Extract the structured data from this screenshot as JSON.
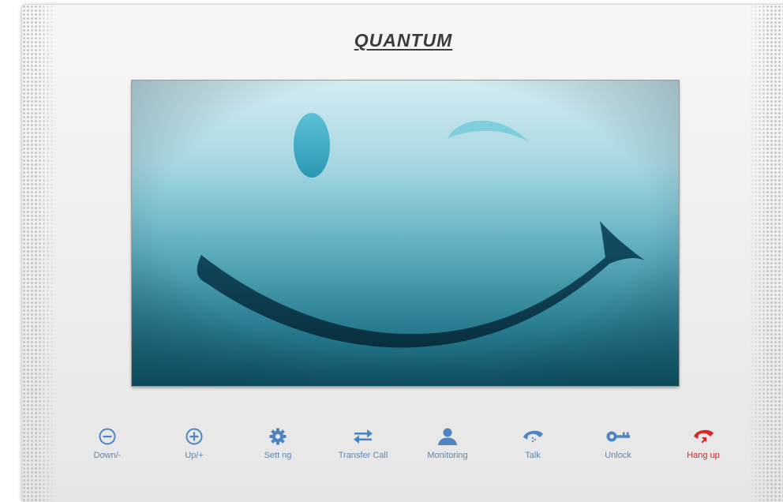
{
  "brand": {
    "title": "QUANTUM"
  },
  "screen": {
    "content": "wink-smiley-face",
    "colors": {
      "top": "#cfeaf0",
      "middle": "#5fb3c4",
      "bottom": "#0f5468",
      "features": "#2b9cb5",
      "mouth": "#0b3a4f"
    }
  },
  "controls": [
    {
      "id": "down",
      "label": "Down/-",
      "icon": "minus-circle-icon",
      "color": "#4f84c2"
    },
    {
      "id": "up",
      "label": "Up/+",
      "icon": "plus-circle-icon",
      "color": "#4f84c2"
    },
    {
      "id": "setting",
      "label": "Sett ng",
      "icon": "gear-icon",
      "color": "#4f84c2"
    },
    {
      "id": "transfer",
      "label": "Transfer Call",
      "icon": "transfer-arrows-icon",
      "color": "#4f84c2"
    },
    {
      "id": "monitoring",
      "label": "Monitoring",
      "icon": "person-icon",
      "color": "#4f84c2"
    },
    {
      "id": "talk",
      "label": "Talk",
      "icon": "phone-handset-icon",
      "color": "#4f84c2"
    },
    {
      "id": "unlock",
      "label": "Unlock",
      "icon": "key-icon",
      "color": "#4f84c2"
    },
    {
      "id": "hangup",
      "label": "Hang up",
      "icon": "hang-up-icon",
      "color": "#d42a2a"
    }
  ]
}
